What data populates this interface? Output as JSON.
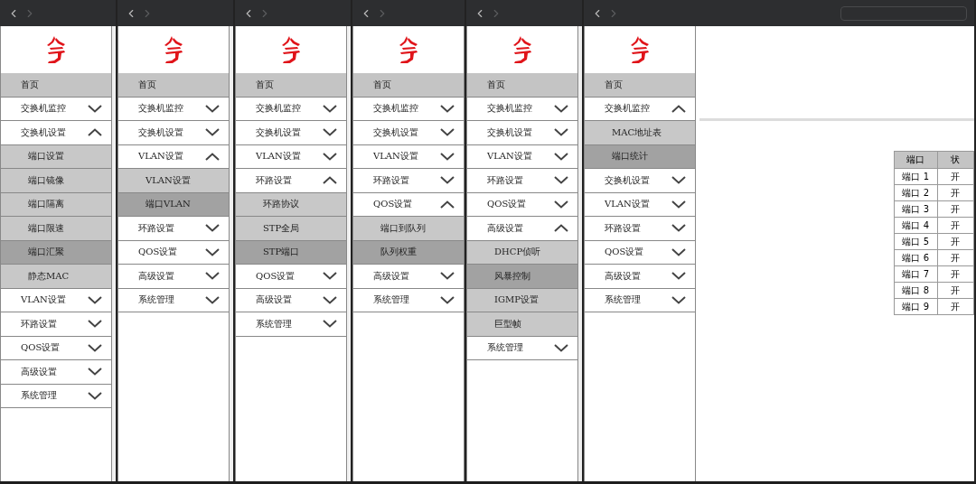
{
  "panels": [
    {
      "nav": [
        {
          "kind": "home",
          "label": "首页"
        },
        {
          "kind": "group",
          "label": "交换机监控",
          "expanded": false
        },
        {
          "kind": "group",
          "label": "交换机设置",
          "expanded": true,
          "children": [
            {
              "label": "端口设置",
              "selected": false
            },
            {
              "label": "端口镜像",
              "selected": false
            },
            {
              "label": "端口隔离",
              "selected": false
            },
            {
              "label": "端口限速",
              "selected": false
            },
            {
              "label": "端口汇聚",
              "selected": true
            },
            {
              "label": "静态MAC",
              "selected": false
            }
          ]
        },
        {
          "kind": "group",
          "label": "VLAN设置",
          "expanded": false
        },
        {
          "kind": "group",
          "label": "环路设置",
          "expanded": false
        },
        {
          "kind": "group",
          "label": "QOS设置",
          "expanded": false
        },
        {
          "kind": "group",
          "label": "高级设置",
          "expanded": false
        },
        {
          "kind": "group",
          "label": "系统管理",
          "expanded": false
        }
      ]
    },
    {
      "nav": [
        {
          "kind": "home",
          "label": "首页"
        },
        {
          "kind": "group",
          "label": "交换机监控",
          "expanded": false
        },
        {
          "kind": "group",
          "label": "交换机设置",
          "expanded": false
        },
        {
          "kind": "group",
          "label": "VLAN设置",
          "expanded": true,
          "children": [
            {
              "label": "VLAN设置",
              "selected": false
            },
            {
              "label": "端口VLAN",
              "selected": true
            }
          ]
        },
        {
          "kind": "group",
          "label": "环路设置",
          "expanded": false
        },
        {
          "kind": "group",
          "label": "QOS设置",
          "expanded": false
        },
        {
          "kind": "group",
          "label": "高级设置",
          "expanded": false
        },
        {
          "kind": "group",
          "label": "系统管理",
          "expanded": false
        }
      ]
    },
    {
      "nav": [
        {
          "kind": "home",
          "label": "首页"
        },
        {
          "kind": "group",
          "label": "交换机监控",
          "expanded": false
        },
        {
          "kind": "group",
          "label": "交换机设置",
          "expanded": false
        },
        {
          "kind": "group",
          "label": "VLAN设置",
          "expanded": false
        },
        {
          "kind": "group",
          "label": "环路设置",
          "expanded": true,
          "children": [
            {
              "label": "环路协议",
              "selected": false
            },
            {
              "label": "STP全局",
              "selected": false
            },
            {
              "label": "STP端口",
              "selected": true
            }
          ]
        },
        {
          "kind": "group",
          "label": "QOS设置",
          "expanded": false
        },
        {
          "kind": "group",
          "label": "高级设置",
          "expanded": false
        },
        {
          "kind": "group",
          "label": "系统管理",
          "expanded": false
        }
      ]
    },
    {
      "nav": [
        {
          "kind": "home",
          "label": "首页"
        },
        {
          "kind": "group",
          "label": "交换机监控",
          "expanded": false
        },
        {
          "kind": "group",
          "label": "交换机设置",
          "expanded": false
        },
        {
          "kind": "group",
          "label": "VLAN设置",
          "expanded": false
        },
        {
          "kind": "group",
          "label": "环路设置",
          "expanded": false
        },
        {
          "kind": "group",
          "label": "QOS设置",
          "expanded": true,
          "children": [
            {
              "label": "端口到队列",
              "selected": false
            },
            {
              "label": "队列权重",
              "selected": true
            }
          ]
        },
        {
          "kind": "group",
          "label": "高级设置",
          "expanded": false
        },
        {
          "kind": "group",
          "label": "系统管理",
          "expanded": false
        }
      ]
    },
    {
      "nav": [
        {
          "kind": "home",
          "label": "首页"
        },
        {
          "kind": "group",
          "label": "交换机监控",
          "expanded": false
        },
        {
          "kind": "group",
          "label": "交换机设置",
          "expanded": false
        },
        {
          "kind": "group",
          "label": "VLAN设置",
          "expanded": false
        },
        {
          "kind": "group",
          "label": "环路设置",
          "expanded": false
        },
        {
          "kind": "group",
          "label": "QOS设置",
          "expanded": false
        },
        {
          "kind": "group",
          "label": "高级设置",
          "expanded": true,
          "children": [
            {
              "label": "DHCP侦听",
              "selected": false
            },
            {
              "label": "风暴控制",
              "selected": true
            },
            {
              "label": "IGMP设置",
              "selected": false
            },
            {
              "label": "巨型帧",
              "selected": false
            }
          ]
        },
        {
          "kind": "group",
          "label": "系统管理",
          "expanded": false
        }
      ]
    },
    {
      "nav": [
        {
          "kind": "home",
          "label": "首页"
        },
        {
          "kind": "group",
          "label": "交换机监控",
          "expanded": true,
          "children": [
            {
              "label": "MAC地址表",
              "selected": false
            },
            {
              "label": "端口统计",
              "selected": true
            }
          ]
        },
        {
          "kind": "group",
          "label": "交换机设置",
          "expanded": false
        },
        {
          "kind": "group",
          "label": "VLAN设置",
          "expanded": false
        },
        {
          "kind": "group",
          "label": "环路设置",
          "expanded": false
        },
        {
          "kind": "group",
          "label": "QOS设置",
          "expanded": false
        },
        {
          "kind": "group",
          "label": "高级设置",
          "expanded": false
        },
        {
          "kind": "group",
          "label": "系统管理",
          "expanded": false
        }
      ],
      "table": {
        "columns": [
          "端口",
          "状"
        ],
        "rows": [
          [
            "端口 1",
            "开"
          ],
          [
            "端口 2",
            "开"
          ],
          [
            "端口 3",
            "开"
          ],
          [
            "端口 4",
            "开"
          ],
          [
            "端口 5",
            "开"
          ],
          [
            "端口 6",
            "开"
          ],
          [
            "端口 7",
            "开"
          ],
          [
            "端口 8",
            "开"
          ],
          [
            "端口 9",
            "开"
          ]
        ]
      }
    }
  ]
}
